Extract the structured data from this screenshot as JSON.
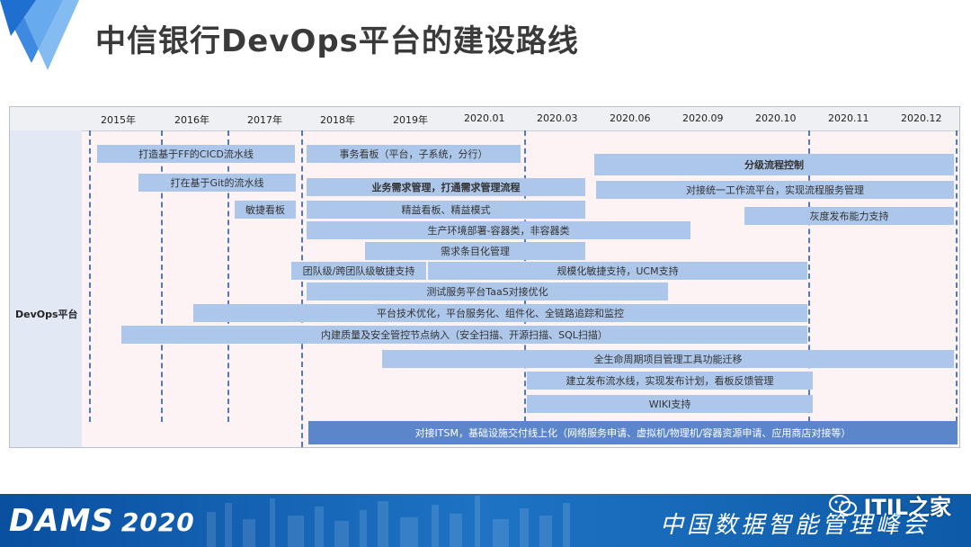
{
  "header": {
    "title": "中信银行DevOps平台的建设路线"
  },
  "timeline": {
    "periods": [
      "2015年",
      "2016年",
      "2017年",
      "2018年",
      "2019年",
      "2020.01",
      "2020.03",
      "2020.06",
      "2020.09",
      "2020.10",
      "2020.11",
      "2020.12"
    ],
    "row_label": "DevOps平台",
    "items": [
      {
        "label": "打造基于FF的CICD流水线"
      },
      {
        "label": "事务看板（平台，子系统，分行）"
      },
      {
        "label": "分级流程控制"
      },
      {
        "label": "打在基于Git的流水线"
      },
      {
        "label": "业务需求管理，打通需求管理流程"
      },
      {
        "label": "对接统一工作流平台，实现流程服务管理"
      },
      {
        "label": "敏捷看板"
      },
      {
        "label": "精益看板、精益模式"
      },
      {
        "label": "灰度发布能力支持"
      },
      {
        "label": "生产环境部署-容器类，非容器类"
      },
      {
        "label": "需求条目化管理"
      },
      {
        "label": "团队级/跨团队级敏捷支持"
      },
      {
        "label": "规模化敏捷支持，UCM支持"
      },
      {
        "label": "测试服务平台TaaS对接优化"
      },
      {
        "label": "平台技术优化，平台服务化、组件化、全链路追踪和监控"
      },
      {
        "label": "内建质量及安全管控节点纳入（安全扫描、开源扫描、SQL扫描）"
      },
      {
        "label": "全生命周期项目管理工具功能迁移"
      },
      {
        "label": "建立发布流水线，实现发布计划，看板反馈管理"
      },
      {
        "label": "WIKI支持"
      },
      {
        "label": "对接ITSM，基础设施交付线上化（网络服务申请、虚拟机/物理机/容器资源申请、应用商店对接等）"
      }
    ]
  },
  "footer": {
    "brand": "DAMS",
    "year": "2020",
    "conference": "中国数据智能管理峰会"
  },
  "watermark": {
    "text": "ITIL之家"
  },
  "colors": {
    "bar": "#adc7eb",
    "bar_dark": "#5c86cc",
    "dashed_line": "#4d79c7",
    "chart_bg": "#fdf3f4",
    "footer": "#1e73c4",
    "logo": "#3d8ae0"
  }
}
